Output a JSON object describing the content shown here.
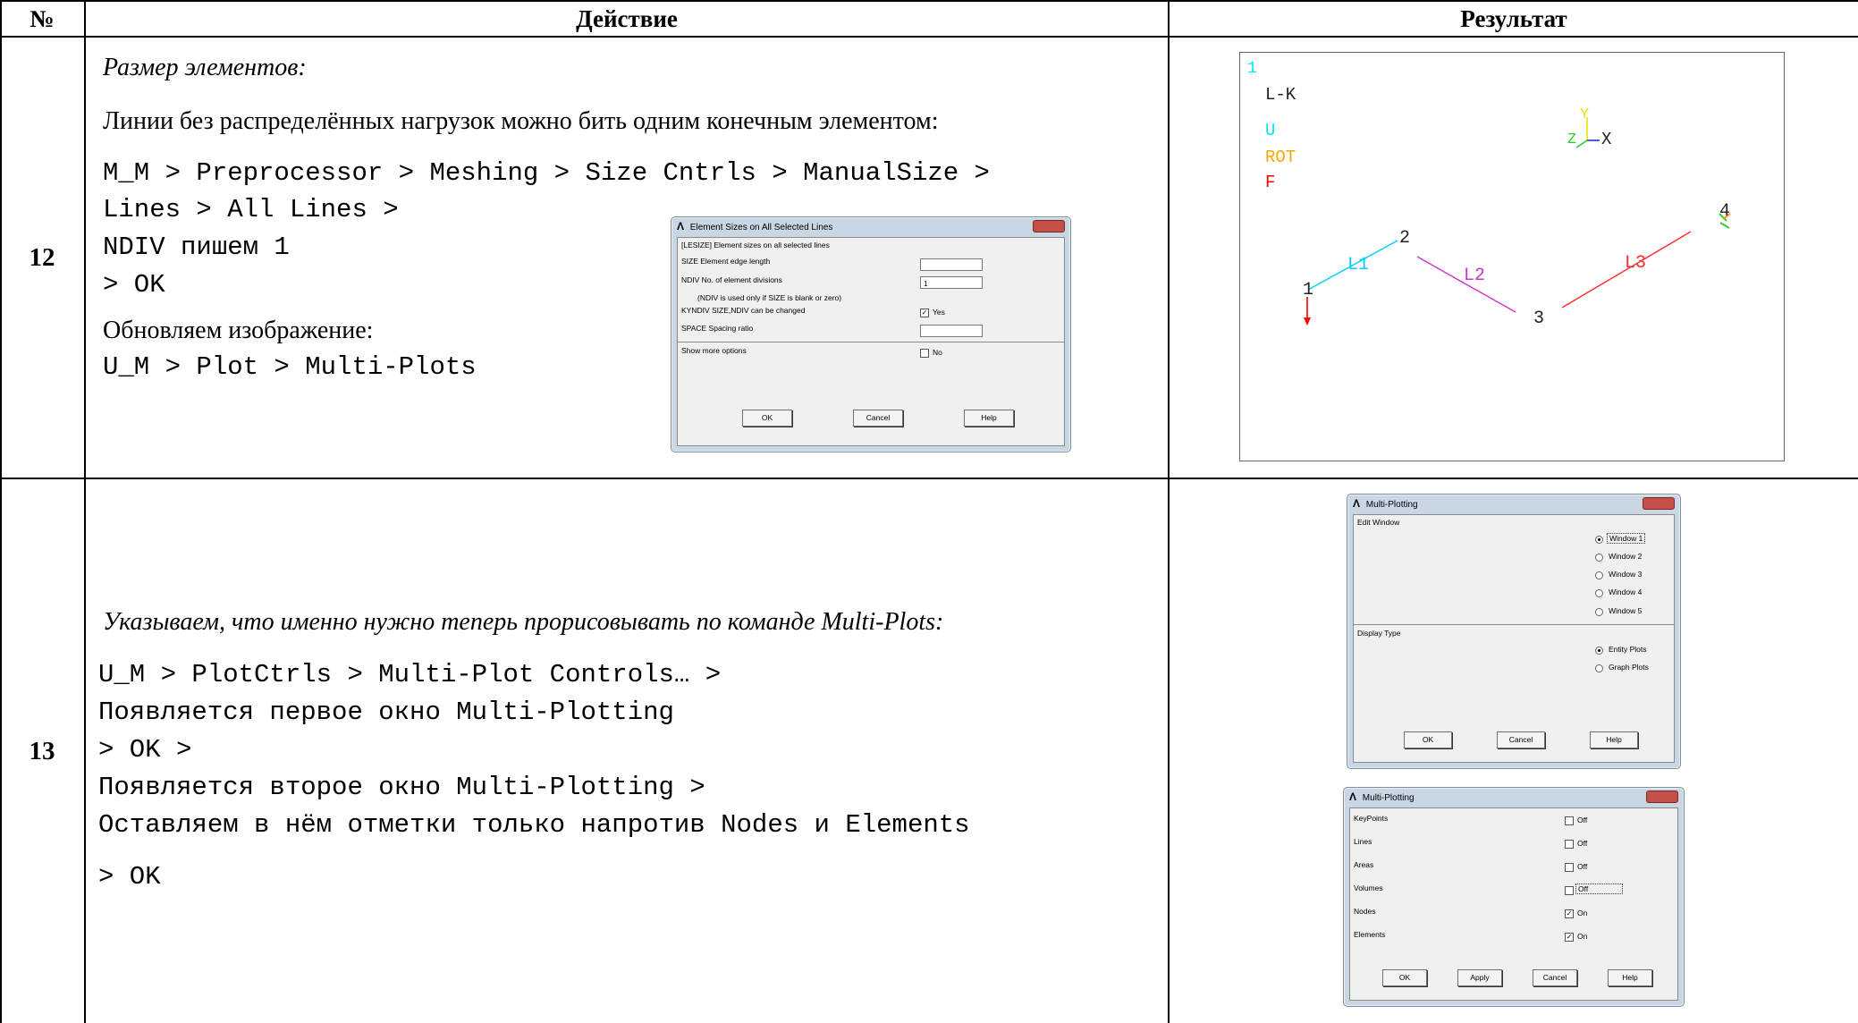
{
  "table": {
    "headers": {
      "num": "№",
      "action": "Действие",
      "result": "Результат"
    }
  },
  "row12": {
    "num": "12",
    "title": "Размер элементов:",
    "text1": "Линии без распределённых нагрузок можно бить одним конечным элементом:",
    "code1": "M_M > Preprocessor > Meshing > Size Cntrls > ManualSize >",
    "code2": "Lines > All Lines >",
    "code3": "NDIV пишем 1",
    "code4": "> OK",
    "text2": "Обновляем изображение:",
    "code5": "U_M > Plot > Multi-Plots",
    "dialog": {
      "title": "Element Sizes on All Selected Lines",
      "header": "[LESIZE]  Element sizes on all selected lines",
      "size_label": "SIZE   Element edge length",
      "size_value": "",
      "ndiv_label": "NDIV    No. of element divisions",
      "ndiv_value": "1",
      "ndiv_note": "(NDIV is used only if SIZE is blank or zero)",
      "kyndiv_label": "KYNDIV  SIZE,NDIV can be changed",
      "kyndiv_value": "Yes",
      "space_label": "SPACE   Spacing ratio",
      "space_value": "",
      "more_label": "Show more options",
      "more_value": "No",
      "ok": "OK",
      "cancel": "Cancel",
      "help": "Help"
    },
    "plot": {
      "window_num": "1",
      "legend_title": "L-K",
      "legend_u": "U",
      "legend_rot": "ROT",
      "legend_f": "F",
      "axis_y": "Y",
      "axis_z": "Z",
      "axis_x": "X",
      "kp1": "1",
      "kp2": "2",
      "kp3": "3",
      "kp4": "4",
      "l1": "L1",
      "l2": "L2",
      "l3": "L3",
      "color_u": "#00e5ff",
      "color_rot": "#ffa500",
      "color_f": "#ff0000",
      "color_l1": "#00cfff",
      "color_l2": "#cc33cc",
      "color_l3": "#ff2a2a"
    }
  },
  "row13": {
    "num": "13",
    "title": "Указываем, что именно нужно теперь прорисовывать по команде Multi-Plots:",
    "code1": "U_M > PlotCtrls > Multi-Plot Controls… >",
    "code2": "Появляется первое окно Multi-Plotting",
    "code3": "> OK >",
    "code4": "Появляется второе окно Multi-Plotting >",
    "code5": "Оставляем в нём отметки только напротив Nodes и Elements",
    "code6": "> OK",
    "dialog1": {
      "title": "Multi-Plotting",
      "edit_window": "Edit Window",
      "windows": [
        "Window 1",
        "Window 2",
        "Window 3",
        "Window 4",
        "Window 5"
      ],
      "display_type": "Display Type",
      "types": [
        "Entity Plots",
        "Graph Plots"
      ],
      "ok": "OK",
      "cancel": "Cancel",
      "help": "Help"
    },
    "dialog2": {
      "title": "Multi-Plotting",
      "items": [
        {
          "label": "KeyPoints",
          "value": "Off"
        },
        {
          "label": "Lines",
          "value": "Off"
        },
        {
          "label": "Areas",
          "value": "Off"
        },
        {
          "label": "Volumes",
          "value": "Off"
        },
        {
          "label": "Nodes",
          "value": "On"
        },
        {
          "label": "Elements",
          "value": "On"
        }
      ],
      "ok": "OK",
      "apply": "Apply",
      "cancel": "Cancel",
      "help": "Help"
    }
  }
}
